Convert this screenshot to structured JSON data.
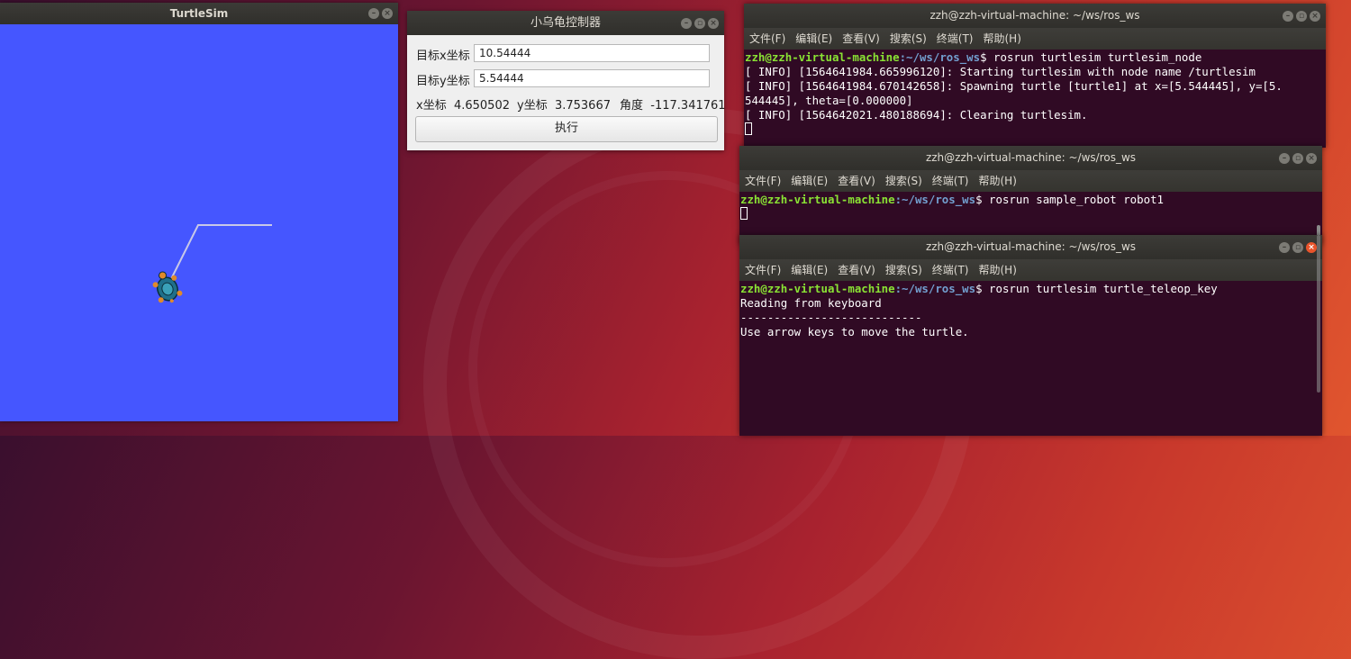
{
  "turtlesim": {
    "title": "TurtleSim",
    "background": "#4556ff",
    "path_color": "#c8c8e8"
  },
  "controller": {
    "title": "小乌龟控制器",
    "target_x_label": "目标x坐标",
    "target_x_value": "10.54444",
    "target_y_label": "目标y坐标",
    "target_y_value": "5.54444",
    "x_label": "x坐标",
    "x_value": "4.650502",
    "y_label": "y坐标",
    "y_value": "3.753667",
    "angle_label": "角度",
    "angle_value": "-117.341761",
    "execute_label": "执行"
  },
  "menu": [
    "文件(F)",
    "编辑(E)",
    "查看(V)",
    "搜索(S)",
    "终端(T)",
    "帮助(H)"
  ],
  "terminal1": {
    "title": "zzh@zzh-virtual-machine: ~/ws/ros_ws",
    "prompt_user": "zzh@zzh-virtual-machine",
    "prompt_path": ":~/ws/ros_ws",
    "prompt_tail": "$ rosrun turtlesim turtlesim_node",
    "line1": "[ INFO] [1564641984.665996120]: Starting turtlesim with node name /turtlesim",
    "line2": "[ INFO] [1564641984.670142658]: Spawning turtle [turtle1] at x=[5.544445], y=[5.",
    "line3": "544445], theta=[0.000000]",
    "line4": "[ INFO] [1564642021.480188694]: Clearing turtlesim."
  },
  "terminal2": {
    "title": "zzh@zzh-virtual-machine: ~/ws/ros_ws",
    "prompt_user": "zzh@zzh-virtual-machine",
    "prompt_path": ":~/ws/ros_ws",
    "prompt_tail": "$ rosrun sample_robot robot1"
  },
  "terminal3": {
    "title": "zzh@zzh-virtual-machine: ~/ws/ros_ws",
    "prompt_user": "zzh@zzh-virtual-machine",
    "prompt_path": ":~/ws/ros_ws",
    "prompt_tail": "$ rosrun turtlesim turtle_teleop_key",
    "line1": "Reading from keyboard",
    "line2": "---------------------------",
    "line3": "Use arrow keys to move the turtle."
  },
  "window_buttons": {
    "minimize": "–",
    "maximize": "▫",
    "close": "×"
  }
}
